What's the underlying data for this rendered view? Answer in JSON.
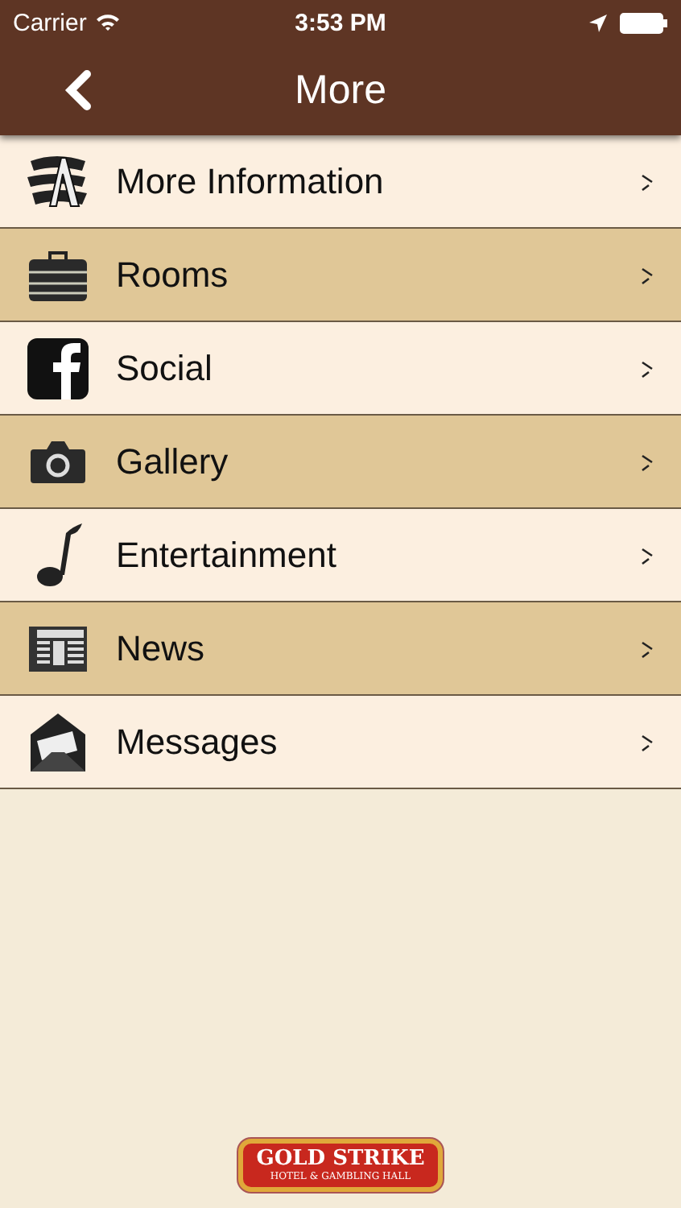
{
  "status_bar": {
    "carrier": "Carrier",
    "time": "3:53 PM"
  },
  "nav_bar": {
    "title": "More"
  },
  "menu": [
    {
      "label": "More Information"
    },
    {
      "label": "Rooms"
    },
    {
      "label": "Social"
    },
    {
      "label": "Gallery"
    },
    {
      "label": "Entertainment"
    },
    {
      "label": "News"
    },
    {
      "label": "Messages"
    }
  ],
  "logo": {
    "name": "GOLD STRIKE",
    "tagline": "HOTEL & GAMBLING HALL"
  }
}
